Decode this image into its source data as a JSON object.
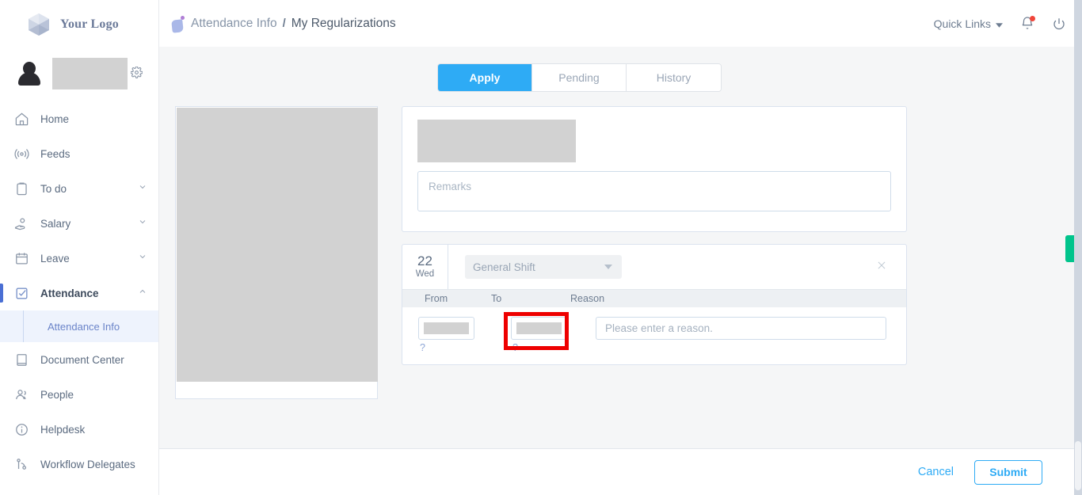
{
  "sidebar": {
    "logo_text": "Your Logo",
    "profile": {
      "name": "",
      "sub": "",
      "gear_icon": "gear-icon"
    },
    "items": [
      {
        "label": "Home",
        "icon": "home-icon",
        "expandable": false,
        "active": false
      },
      {
        "label": "Feeds",
        "icon": "feeds-icon",
        "expandable": false,
        "active": false
      },
      {
        "label": "To do",
        "icon": "clipboard-icon",
        "expandable": true,
        "active": false
      },
      {
        "label": "Salary",
        "icon": "salary-icon",
        "expandable": true,
        "active": false
      },
      {
        "label": "Leave",
        "icon": "calendar-icon",
        "expandable": true,
        "active": false
      },
      {
        "label": "Attendance",
        "icon": "checkbox-icon",
        "expandable": true,
        "active": true
      },
      {
        "label": "Document Center",
        "icon": "book-icon",
        "expandable": false,
        "active": false
      },
      {
        "label": "People",
        "icon": "people-icon",
        "expandable": false,
        "active": false
      },
      {
        "label": "Helpdesk",
        "icon": "info-icon",
        "expandable": false,
        "active": false
      },
      {
        "label": "Workflow Delegates",
        "icon": "workflow-icon",
        "expandable": false,
        "active": false
      }
    ],
    "subitem": {
      "label": "Attendance Info"
    }
  },
  "header": {
    "breadcrumb_parent": "Attendance Info",
    "breadcrumb_separator": "/",
    "breadcrumb_current": "My Regularizations",
    "quick_links": "Quick Links",
    "bell_icon": "bell-icon",
    "power_icon": "power-icon"
  },
  "tabs": [
    {
      "label": "Apply",
      "active": true
    },
    {
      "label": "Pending",
      "active": false
    },
    {
      "label": "History",
      "active": false
    }
  ],
  "form": {
    "remarks_placeholder": "Remarks",
    "remarks_value": ""
  },
  "entry": {
    "date_num": "22",
    "date_day": "Wed",
    "shift_value": "General Shift",
    "close_icon": "close-icon",
    "columns": {
      "from": "From",
      "to": "To",
      "reason": "Reason"
    },
    "from_value": "",
    "from_hint": "?",
    "to_value": "",
    "to_hint": "?",
    "reason_placeholder": "Please enter a reason.",
    "reason_value": ""
  },
  "footer": {
    "cancel_label": "Cancel",
    "submit_label": "Submit",
    "note": ""
  },
  "colors": {
    "accent_blue": "#2eabf5",
    "nav_active": "#4a6fd4",
    "green_tab": "#00c48c",
    "annotation_red": "#ee0000",
    "notification_red": "#f0453a"
  }
}
